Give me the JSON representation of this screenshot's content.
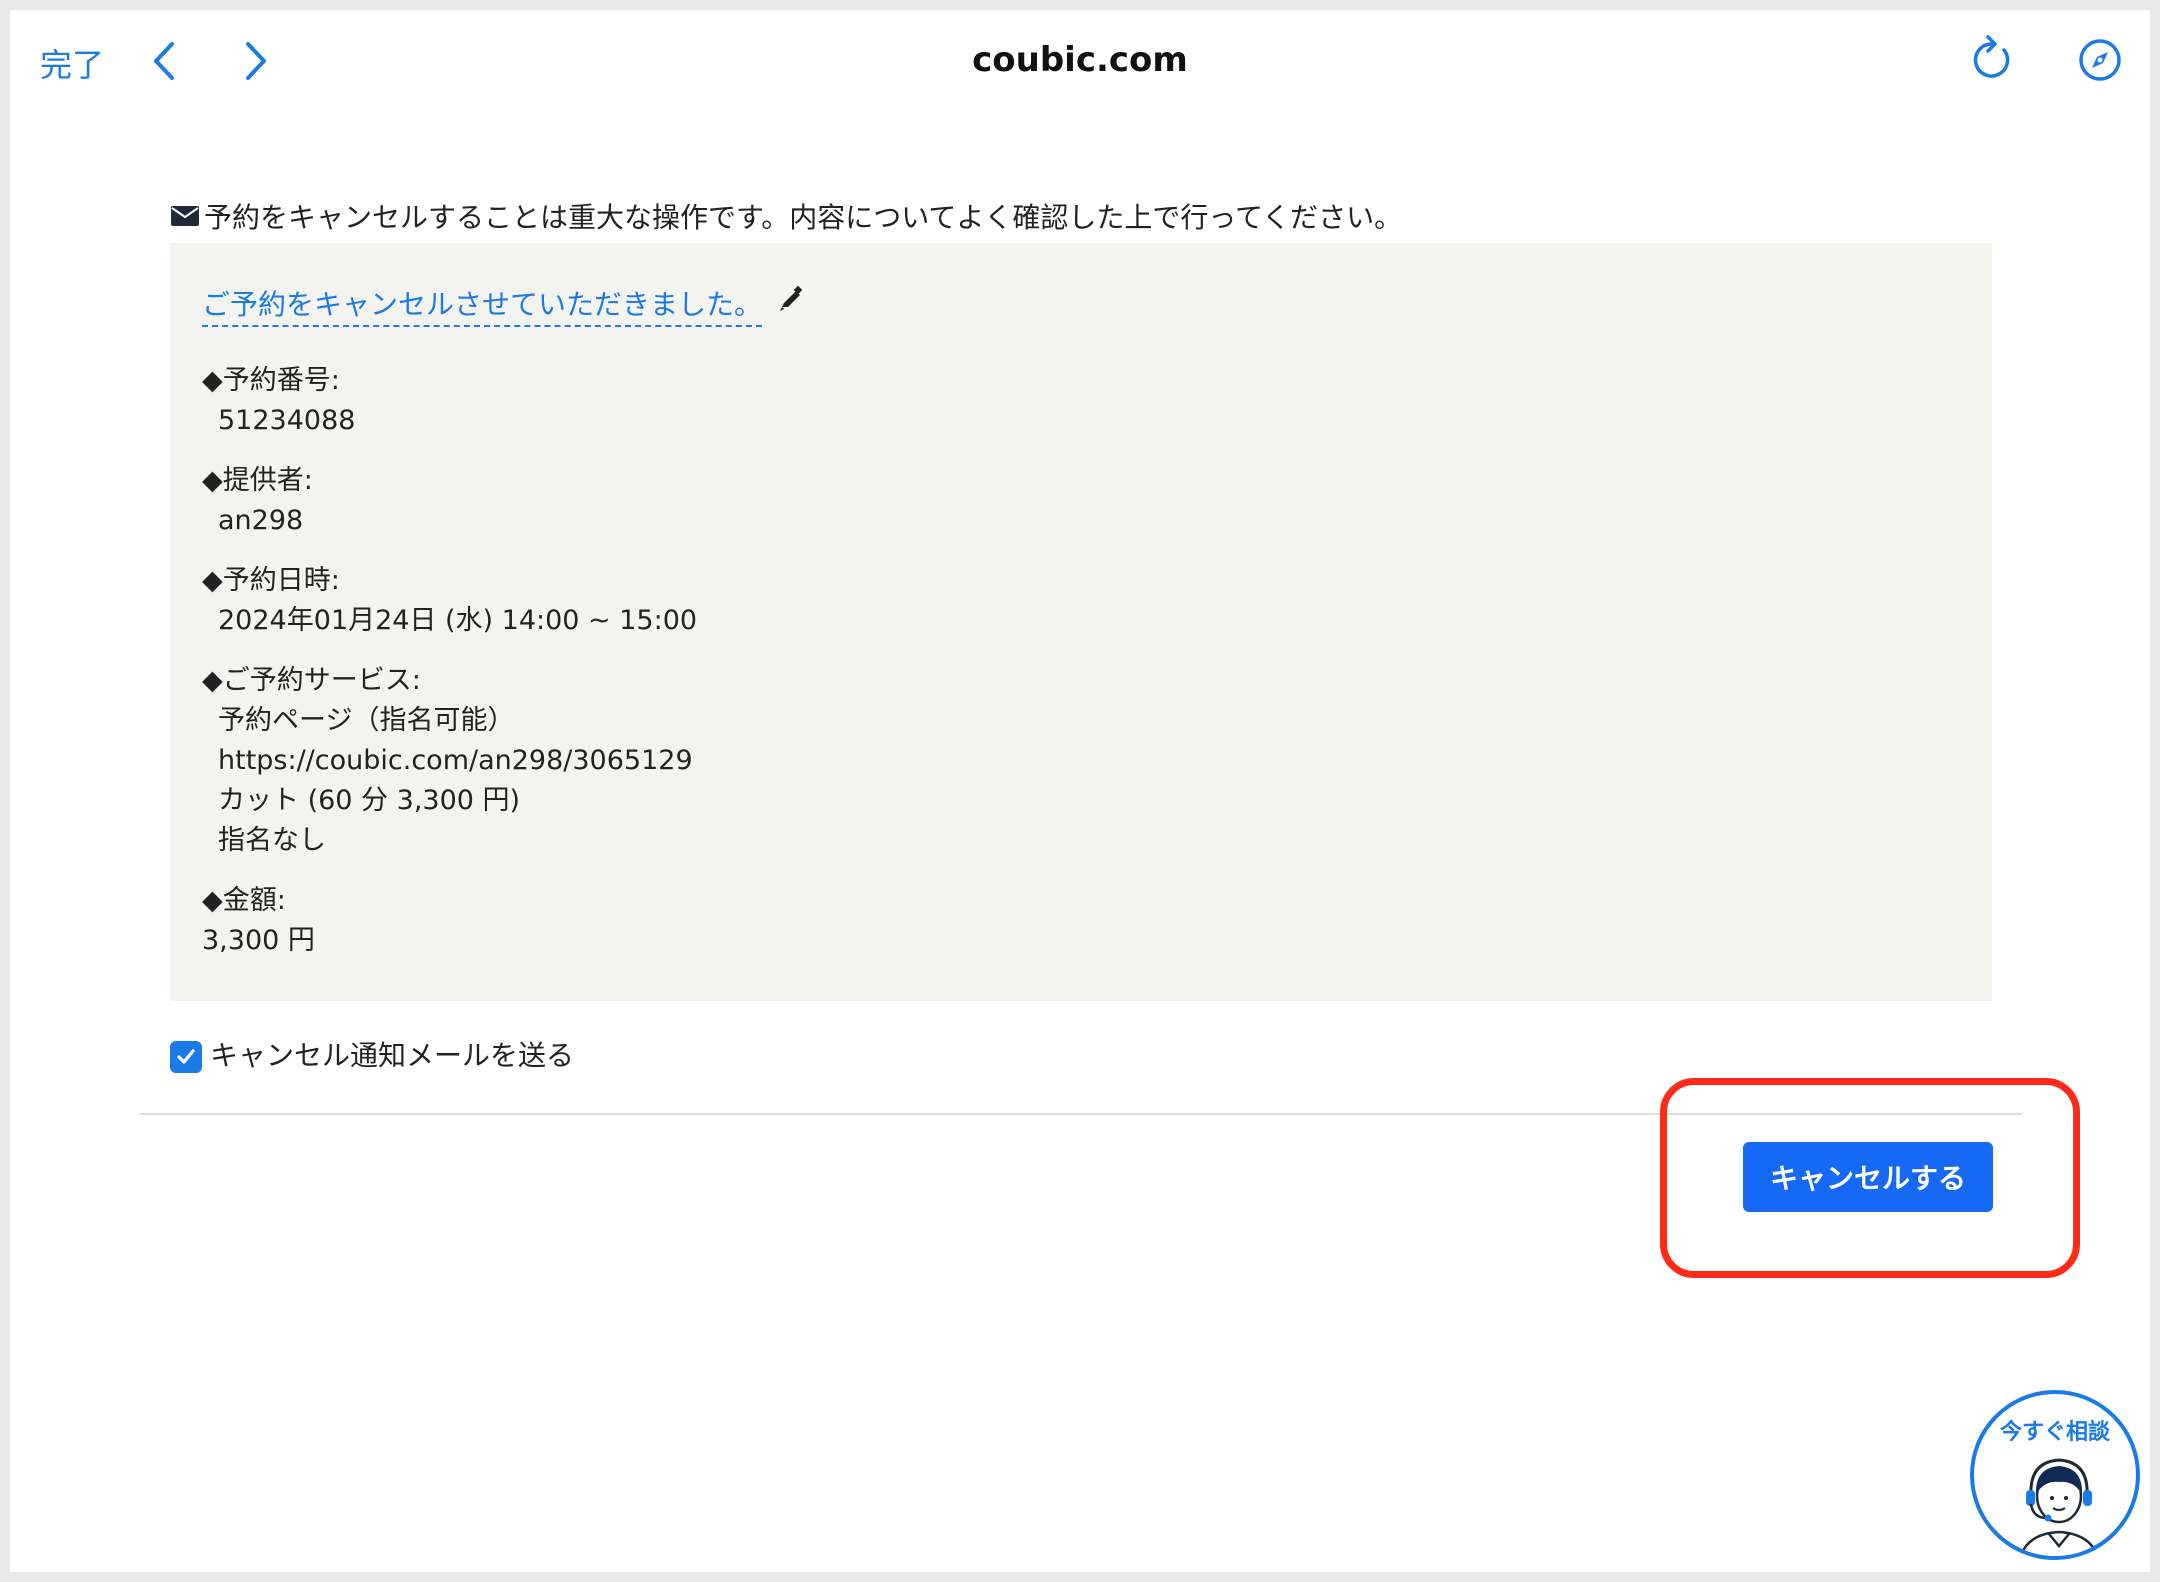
{
  "topbar": {
    "done_label": "完了",
    "title": "coubic.com",
    "icons": [
      "chevron-left-icon",
      "chevron-right-icon",
      "reload-icon",
      "compass-icon"
    ]
  },
  "notice": {
    "icon": "envelope-icon",
    "text": "予約をキャンセルすることは重大な操作です。内容についてよく確認した上で行ってください。"
  },
  "panel": {
    "subject": "ご予約をキャンセルさせていただきました。",
    "edit_icon": "pencil-icon",
    "reservation_number_label": "◆予約番号:",
    "reservation_number": "51234088",
    "provider_label": "◆提供者:",
    "provider": "an298",
    "datetime_label": "◆予約日時:",
    "datetime": "2024年01月24日 (水) 14:00 ~ 15:00",
    "service_label": "◆ご予約サービス:",
    "service_lines": [
      "予約ページ（指名可能）",
      "https://coubic.com/an298/3065129",
      "カット (60 分 3,300 円)",
      "指名なし"
    ],
    "amount_label": "◆金額:",
    "amount": "3,300 円"
  },
  "notify": {
    "label": "キャンセル通知メールを送る",
    "checked": true
  },
  "cancel_button": {
    "label": "キャンセルする"
  },
  "chat": {
    "label": "今すぐ相談",
    "icon": "support-agent-icon"
  },
  "colors": {
    "accent": "#1a7ae6",
    "button": "#1669f5",
    "highlight": "#ff2a17",
    "panel_bg": "#f3f3f0"
  }
}
